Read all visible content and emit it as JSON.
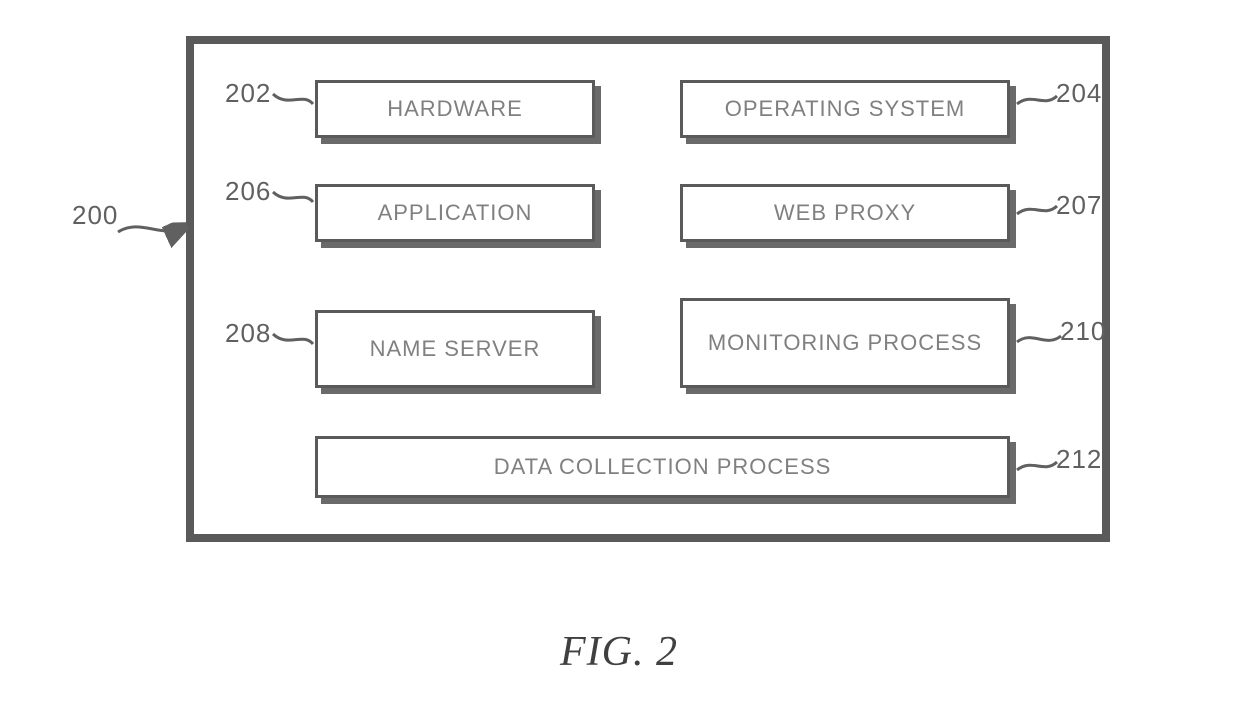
{
  "figure": {
    "caption": "FIG. 2",
    "container_ref": "200",
    "blocks": {
      "hardware": {
        "label": "HARDWARE",
        "ref": "202"
      },
      "os": {
        "label": "OPERATING SYSTEM",
        "ref": "204"
      },
      "application": {
        "label": "APPLICATION",
        "ref": "206"
      },
      "webproxy": {
        "label": "WEB PROXY",
        "ref": "207"
      },
      "nameserver": {
        "label": "NAME SERVER",
        "ref": "208"
      },
      "monitoring": {
        "label": "MONITORING PROCESS",
        "ref": "210"
      },
      "datacollection": {
        "label": "DATA COLLECTION PROCESS",
        "ref": "212"
      }
    }
  }
}
